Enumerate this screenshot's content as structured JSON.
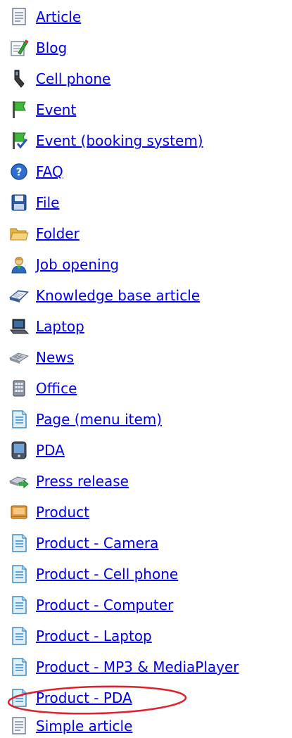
{
  "doc_types": {
    "items": [
      {
        "label": "Article",
        "icon": "article-icon"
      },
      {
        "label": "Blog",
        "icon": "blog-icon"
      },
      {
        "label": "Cell phone",
        "icon": "cell-phone-icon"
      },
      {
        "label": "Event",
        "icon": "event-flag-icon"
      },
      {
        "label": "Event (booking system)",
        "icon": "event-booking-icon"
      },
      {
        "label": "FAQ",
        "icon": "faq-icon"
      },
      {
        "label": "File",
        "icon": "file-floppy-icon"
      },
      {
        "label": "Folder",
        "icon": "folder-icon"
      },
      {
        "label": "Job opening",
        "icon": "job-opening-icon"
      },
      {
        "label": "Knowledge base article",
        "icon": "knowledge-base-icon"
      },
      {
        "label": "Laptop",
        "icon": "laptop-icon"
      },
      {
        "label": "News",
        "icon": "news-icon"
      },
      {
        "label": "Office",
        "icon": "office-icon"
      },
      {
        "label": "Page (menu item)",
        "icon": "page-icon"
      },
      {
        "label": "PDA",
        "icon": "pda-icon"
      },
      {
        "label": "Press release",
        "icon": "press-release-icon"
      },
      {
        "label": "Product",
        "icon": "product-icon"
      },
      {
        "label": "Product - Camera",
        "icon": "page-icon"
      },
      {
        "label": "Product - Cell phone",
        "icon": "page-icon"
      },
      {
        "label": "Product - Computer",
        "icon": "page-icon"
      },
      {
        "label": "Product - Laptop",
        "icon": "page-icon"
      },
      {
        "label": "Product - MP3 & MediaPlayer",
        "icon": "page-icon"
      },
      {
        "label": "Product - PDA",
        "icon": "page-icon"
      },
      {
        "label": "Simple article",
        "icon": "article-icon"
      }
    ]
  },
  "highlighted_item": "Product - PDA",
  "colors": {
    "link": "#0000ee",
    "highlight_ellipse": "#e0202a"
  }
}
